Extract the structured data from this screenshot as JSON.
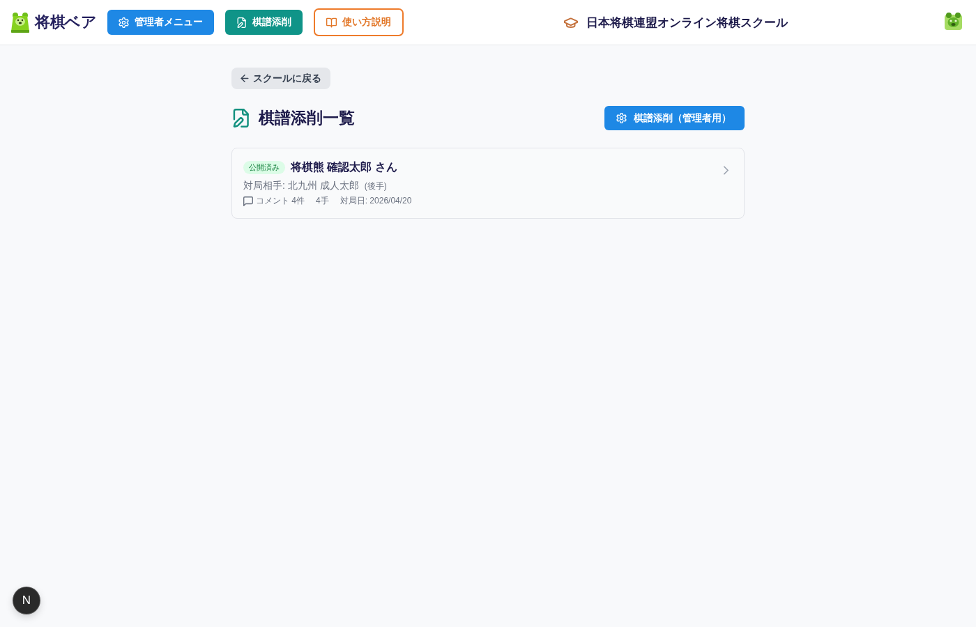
{
  "header": {
    "logo": {
      "text": "将棋ベア"
    },
    "nav_buttons": [
      {
        "label": "管理者メニュー",
        "kind": "admin"
      },
      {
        "label": "棋譜添削",
        "kind": "review"
      },
      {
        "label": "使い方説明",
        "kind": "guide"
      }
    ],
    "school_title": "日本将棋連盟オンライン将棋スクール"
  },
  "back_button": {
    "label": "スクールに戻る"
  },
  "page_title": "棋譜添削一覧",
  "admin_button": {
    "label": "棋譜添削（管理者用）"
  },
  "records": [
    {
      "status": "公開済み",
      "student": "将棋熊 確認太郎 さん",
      "opponent": "対局相手: 北九州 成人太郎",
      "side": "(後手)",
      "comments": "コメント 4件",
      "moves": "4手",
      "date": "対局日: 2026/04/20"
    }
  ],
  "dev_badge": {
    "label": "N"
  }
}
